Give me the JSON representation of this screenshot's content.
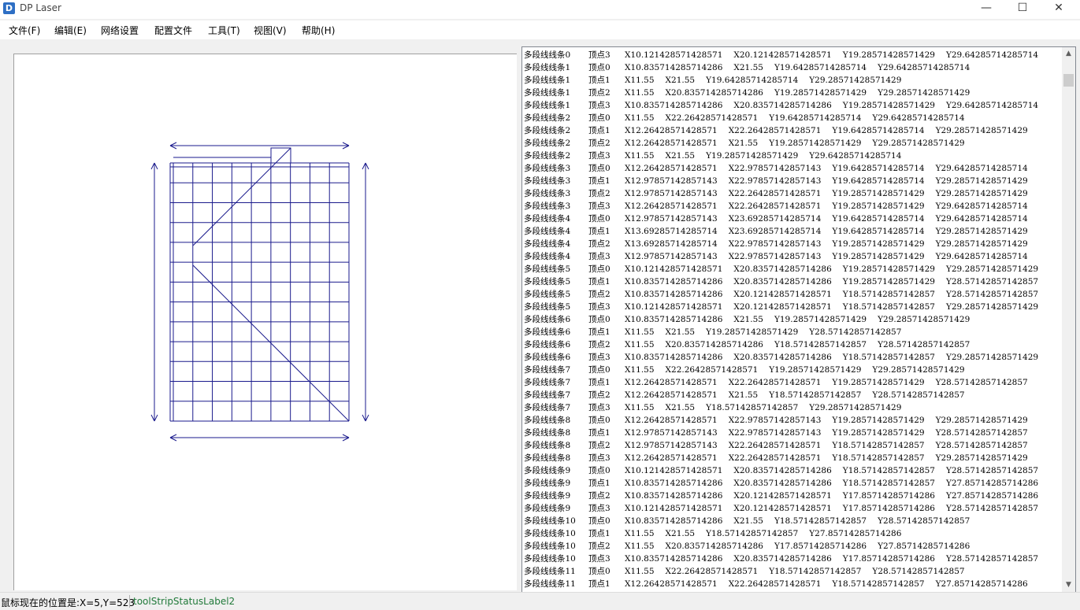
{
  "window": {
    "title": "DP Laser",
    "icon": "app-logo-icon",
    "controls": {
      "minimize": "—",
      "maximize": "☐",
      "close": "✕"
    }
  },
  "menu": [
    {
      "label": "文件(F)"
    },
    {
      "label": "编辑(E)"
    },
    {
      "label": "网络设置"
    },
    {
      "label": "配置文件"
    },
    {
      "label": "工具(T)"
    },
    {
      "label": "视图(V)"
    },
    {
      "label": "帮助(H)"
    }
  ],
  "drawing": {
    "color": "#1a1a8c",
    "grid_columns": 9,
    "grid_rows": 13,
    "arrows": [
      "top-horizontal",
      "bottom-horizontal",
      "left-vertical",
      "right-vertical"
    ]
  },
  "log": [
    [
      "多段线线条0",
      "顶点3",
      "X10.121428571428571",
      "X20.121428571428571",
      "Y19.28571428571429",
      "Y29.64285714285714"
    ],
    [
      "多段线线条1",
      "顶点0",
      "X10.835714285714286",
      "X21.55",
      "Y19.64285714285714",
      "Y29.64285714285714"
    ],
    [
      "多段线线条1",
      "顶点1",
      "X11.55",
      "X21.55",
      "Y19.64285714285714",
      "Y29.28571428571429"
    ],
    [
      "多段线线条1",
      "顶点2",
      "X11.55",
      "X20.835714285714286",
      "Y19.28571428571429",
      "Y29.28571428571429"
    ],
    [
      "多段线线条1",
      "顶点3",
      "X10.835714285714286",
      "X20.835714285714286",
      "Y19.28571428571429",
      "Y29.64285714285714"
    ],
    [
      "多段线线条2",
      "顶点0",
      "X11.55",
      "X22.26428571428571",
      "Y19.64285714285714",
      "Y29.64285714285714"
    ],
    [
      "多段线线条2",
      "顶点1",
      "X12.26428571428571",
      "X22.26428571428571",
      "Y19.64285714285714",
      "Y29.28571428571429"
    ],
    [
      "多段线线条2",
      "顶点2",
      "X12.26428571428571",
      "X21.55",
      "Y19.28571428571429",
      "Y29.28571428571429"
    ],
    [
      "多段线线条2",
      "顶点3",
      "X11.55",
      "X21.55",
      "Y19.28571428571429",
      "Y29.64285714285714"
    ],
    [
      "多段线线条3",
      "顶点0",
      "X12.26428571428571",
      "X22.97857142857143",
      "Y19.64285714285714",
      "Y29.64285714285714"
    ],
    [
      "多段线线条3",
      "顶点1",
      "X12.97857142857143",
      "X22.97857142857143",
      "Y19.64285714285714",
      "Y29.28571428571429"
    ],
    [
      "多段线线条3",
      "顶点2",
      "X12.97857142857143",
      "X22.26428571428571",
      "Y19.28571428571429",
      "Y29.28571428571429"
    ],
    [
      "多段线线条3",
      "顶点3",
      "X12.26428571428571",
      "X22.26428571428571",
      "Y19.28571428571429",
      "Y29.64285714285714"
    ],
    [
      "多段线线条4",
      "顶点0",
      "X12.97857142857143",
      "X23.69285714285714",
      "Y19.64285714285714",
      "Y29.64285714285714"
    ],
    [
      "多段线线条4",
      "顶点1",
      "X13.69285714285714",
      "X23.69285714285714",
      "Y19.64285714285714",
      "Y29.28571428571429"
    ],
    [
      "多段线线条4",
      "顶点2",
      "X13.69285714285714",
      "X22.97857142857143",
      "Y19.28571428571429",
      "Y29.28571428571429"
    ],
    [
      "多段线线条4",
      "顶点3",
      "X12.97857142857143",
      "X22.97857142857143",
      "Y19.28571428571429",
      "Y29.64285714285714"
    ],
    [
      "多段线线条5",
      "顶点0",
      "X10.121428571428571",
      "X20.835714285714286",
      "Y19.28571428571429",
      "Y29.28571428571429"
    ],
    [
      "多段线线条5",
      "顶点1",
      "X10.835714285714286",
      "X20.835714285714286",
      "Y19.28571428571429",
      "Y28.57142857142857"
    ],
    [
      "多段线线条5",
      "顶点2",
      "X10.835714285714286",
      "X20.121428571428571",
      "Y18.57142857142857",
      "Y28.57142857142857"
    ],
    [
      "多段线线条5",
      "顶点3",
      "X10.121428571428571",
      "X20.121428571428571",
      "Y18.57142857142857",
      "Y29.28571428571429"
    ],
    [
      "多段线线条6",
      "顶点0",
      "X10.835714285714286",
      "X21.55",
      "Y19.28571428571429",
      "Y29.28571428571429"
    ],
    [
      "多段线线条6",
      "顶点1",
      "X11.55",
      "X21.55",
      "Y19.28571428571429",
      "Y28.57142857142857"
    ],
    [
      "多段线线条6",
      "顶点2",
      "X11.55",
      "X20.835714285714286",
      "Y18.57142857142857",
      "Y28.57142857142857"
    ],
    [
      "多段线线条6",
      "顶点3",
      "X10.835714285714286",
      "X20.835714285714286",
      "Y18.57142857142857",
      "Y29.28571428571429"
    ],
    [
      "多段线线条7",
      "顶点0",
      "X11.55",
      "X22.26428571428571",
      "Y19.28571428571429",
      "Y29.28571428571429"
    ],
    [
      "多段线线条7",
      "顶点1",
      "X12.26428571428571",
      "X22.26428571428571",
      "Y19.28571428571429",
      "Y28.57142857142857"
    ],
    [
      "多段线线条7",
      "顶点2",
      "X12.26428571428571",
      "X21.55",
      "Y18.57142857142857",
      "Y28.57142857142857"
    ],
    [
      "多段线线条7",
      "顶点3",
      "X11.55",
      "X21.55",
      "Y18.57142857142857",
      "Y29.28571428571429"
    ],
    [
      "多段线线条8",
      "顶点0",
      "X12.26428571428571",
      "X22.97857142857143",
      "Y19.28571428571429",
      "Y29.28571428571429"
    ],
    [
      "多段线线条8",
      "顶点1",
      "X12.97857142857143",
      "X22.97857142857143",
      "Y19.28571428571429",
      "Y28.57142857142857"
    ],
    [
      "多段线线条8",
      "顶点2",
      "X12.97857142857143",
      "X22.26428571428571",
      "Y18.57142857142857",
      "Y28.57142857142857"
    ],
    [
      "多段线线条8",
      "顶点3",
      "X12.26428571428571",
      "X22.26428571428571",
      "Y18.57142857142857",
      "Y29.28571428571429"
    ],
    [
      "多段线线条9",
      "顶点0",
      "X10.121428571428571",
      "X20.835714285714286",
      "Y18.57142857142857",
      "Y28.57142857142857"
    ],
    [
      "多段线线条9",
      "顶点1",
      "X10.835714285714286",
      "X20.835714285714286",
      "Y18.57142857142857",
      "Y27.85714285714286"
    ],
    [
      "多段线线条9",
      "顶点2",
      "X10.835714285714286",
      "X20.121428571428571",
      "Y17.85714285714286",
      "Y27.85714285714286"
    ],
    [
      "多段线线条9",
      "顶点3",
      "X10.121428571428571",
      "X20.121428571428571",
      "Y17.85714285714286",
      "Y28.57142857142857"
    ],
    [
      "多段线线条10",
      "顶点0",
      "X10.835714285714286",
      "X21.55",
      "Y18.57142857142857",
      "Y28.57142857142857"
    ],
    [
      "多段线线条10",
      "顶点1",
      "X11.55",
      "X21.55",
      "Y18.57142857142857",
      "Y27.85714285714286"
    ],
    [
      "多段线线条10",
      "顶点2",
      "X11.55",
      "X20.835714285714286",
      "Y17.85714285714286",
      "Y27.85714285714286"
    ],
    [
      "多段线线条10",
      "顶点3",
      "X10.835714285714286",
      "X20.835714285714286",
      "Y17.85714285714286",
      "Y28.57142857142857"
    ],
    [
      "多段线线条11",
      "顶点0",
      "X11.55",
      "X22.26428571428571",
      "Y18.57142857142857",
      "Y28.57142857142857"
    ],
    [
      "多段线线条11",
      "顶点1",
      "X12.26428571428571",
      "X22.26428571428571",
      "Y18.57142857142857",
      "Y27.85714285714286"
    ]
  ],
  "status": {
    "position_text": "鼠标现在的位置是:X=5,Y=523",
    "label2": "toolStripStatusLabel2"
  }
}
